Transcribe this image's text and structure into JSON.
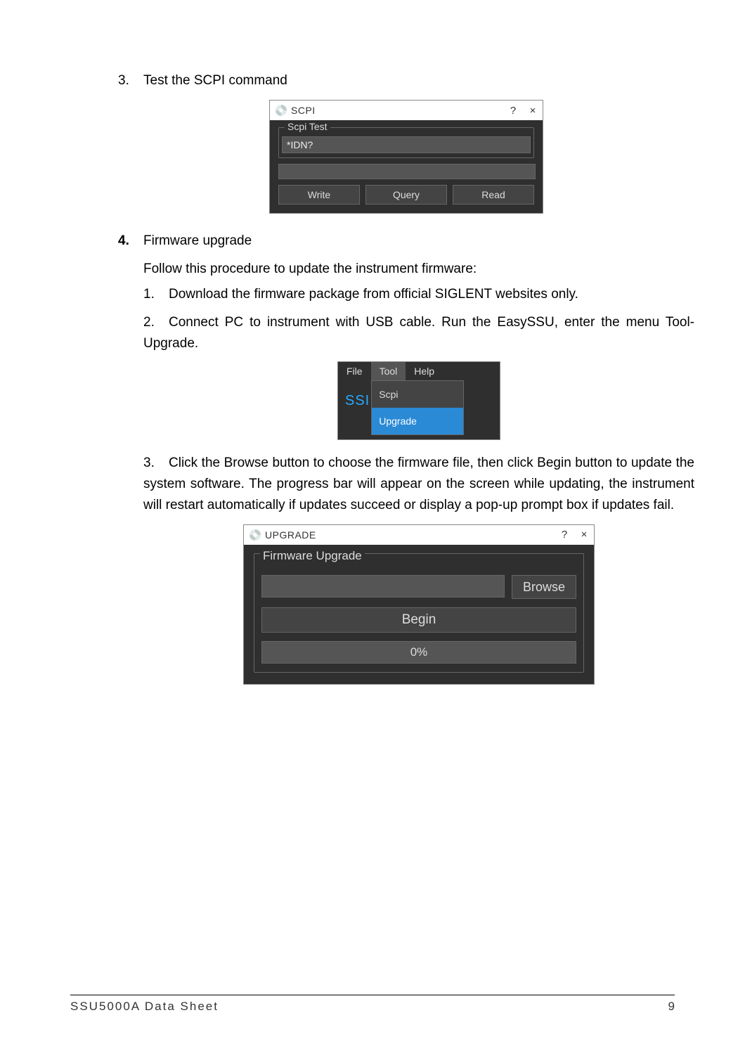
{
  "list3": {
    "num": "3.",
    "text": "Test the SCPI command"
  },
  "scpi_window": {
    "title": "SCPI",
    "help": "?",
    "close": "×",
    "legend": "Scpi Test",
    "input_value": "*IDN?",
    "btn_write": "Write",
    "btn_query": "Query",
    "btn_read": "Read"
  },
  "list4": {
    "num": "4.",
    "heading": "Firmware upgrade",
    "intro": "Follow this procedure to update the instrument firmware:",
    "step1_num": "1.",
    "step1": "Download the firmware package from official SIGLENT websites only.",
    "step2_num": "2.",
    "step2": "Connect PC to instrument with USB cable. Run the EasySSU, enter the menu Tool-Upgrade.",
    "step3_num": "3.",
    "step3": "Click the Browse button to choose the firmware file, then click Begin button to update the system software. The progress bar will appear on the screen while updating, the instrument will restart automatically if updates succeed or display a pop-up prompt box if updates fail."
  },
  "menu_window": {
    "file": "File",
    "tool": "Tool",
    "help": "Help",
    "ssi": "SSI",
    "scpi": "Scpi",
    "upgrade": "Upgrade"
  },
  "upgrade_window": {
    "title": "UPGRADE",
    "help": "?",
    "close": "×",
    "legend": "Firmware Upgrade",
    "browse": "Browse",
    "begin": "Begin",
    "progress": "0%"
  },
  "footer": {
    "left": "SSU5000A Data Sheet",
    "right": "9"
  }
}
